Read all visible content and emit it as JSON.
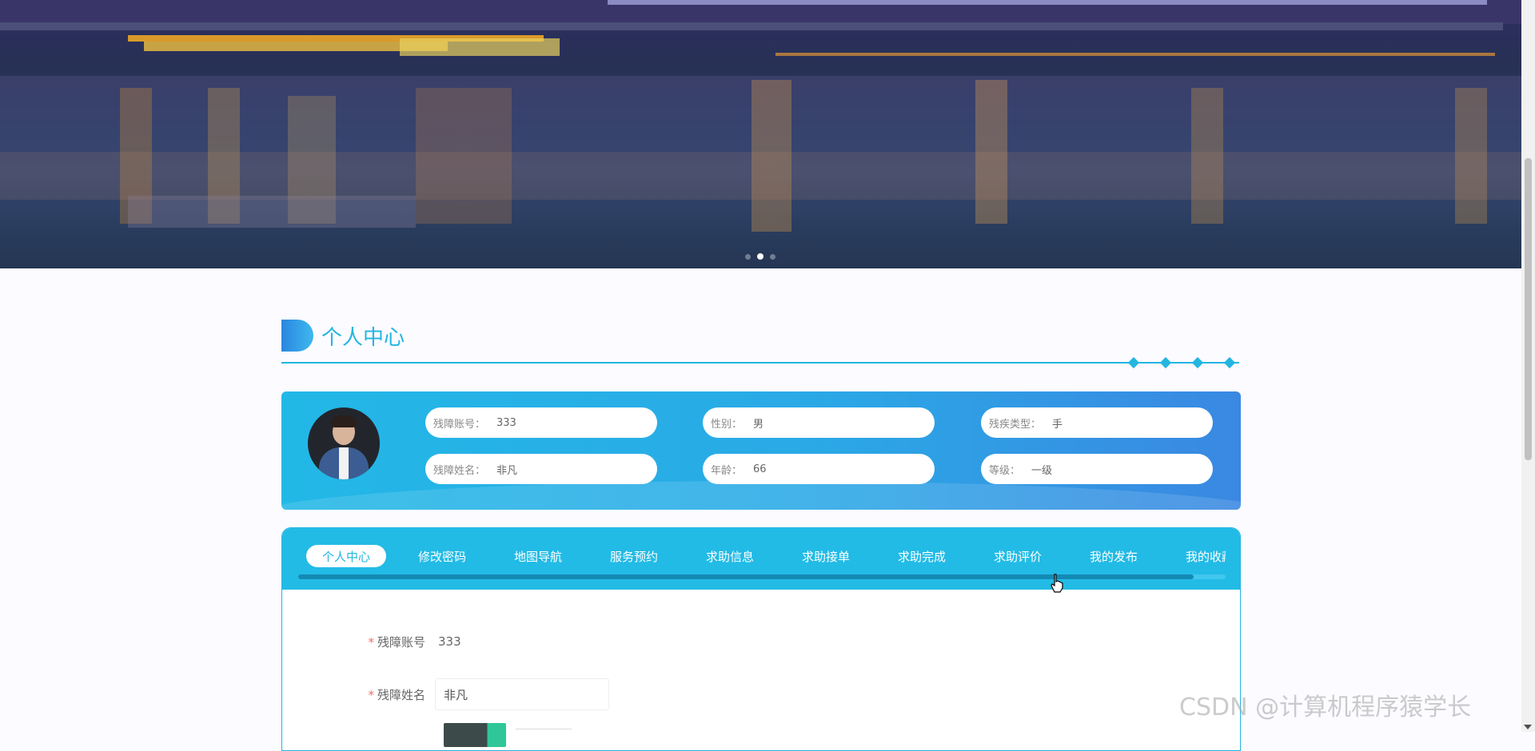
{
  "banner": {
    "slides": 3,
    "active_slide": 2
  },
  "section": {
    "title": "个人中心"
  },
  "profile": {
    "fields": [
      {
        "key": "残障账号：",
        "value": "333"
      },
      {
        "key": "性别：",
        "value": "男"
      },
      {
        "key": "残疾类型：",
        "value": "手"
      },
      {
        "key": "残障姓名：",
        "value": "非凡"
      },
      {
        "key": "年龄：",
        "value": "66"
      },
      {
        "key": "等级：",
        "value": "一级"
      }
    ]
  },
  "tabs": {
    "items": [
      "个人中心",
      "修改密码",
      "地图导航",
      "服务预约",
      "求助信息",
      "求助接单",
      "求助完成",
      "求助评价",
      "我的发布",
      "我的收藏"
    ],
    "active": "个人中心"
  },
  "form": {
    "account_label": "残障账号",
    "account_value": "333",
    "name_label": "残障姓名",
    "name_value": "非凡"
  },
  "watermark": "CSDN @计算机程序猿学长",
  "colors": {
    "accent": "#22b6e0",
    "required": "#f56c6c"
  }
}
